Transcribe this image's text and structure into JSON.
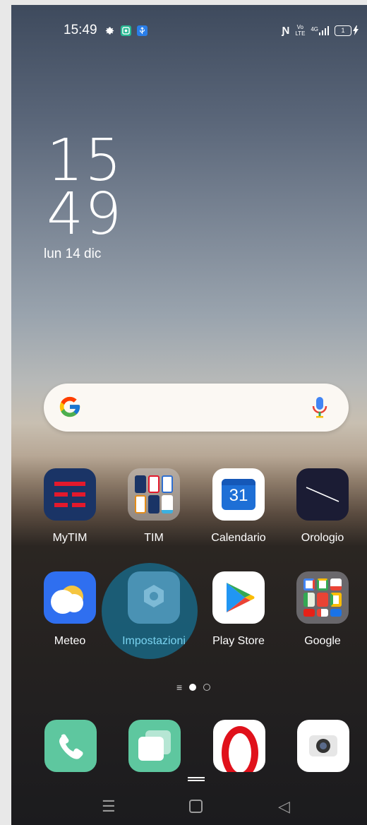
{
  "status_bar": {
    "time": "15:49",
    "left_icons": [
      "gear-icon",
      "screen-record-icon",
      "usb-icon"
    ],
    "right_icons": [
      "nfc-icon",
      "volte-icon",
      "signal-4g-icon",
      "battery-icon"
    ],
    "signal_label": "4G",
    "volte_label": "Vo LTE",
    "battery_level": "1"
  },
  "clock": {
    "hour": "15",
    "minute": "49",
    "date": "lun 14 dic"
  },
  "search": {
    "logo": "G"
  },
  "apps_row1": [
    {
      "label": "MyTIM",
      "icon": "mytim-icon"
    },
    {
      "label": "TIM",
      "icon": "tim-folder-icon"
    },
    {
      "label": "Calendario",
      "icon": "calendar-icon",
      "icon_text": "31"
    },
    {
      "label": "Orologio",
      "icon": "clock-icon"
    }
  ],
  "apps_row2": [
    {
      "label": "Meteo",
      "icon": "weather-icon"
    },
    {
      "label": "Impostazioni",
      "icon": "settings-icon"
    },
    {
      "label": "Play Store",
      "icon": "play-store-icon"
    },
    {
      "label": "Google",
      "icon": "google-folder-icon"
    }
  ],
  "dock": [
    {
      "icon": "phone-icon"
    },
    {
      "icon": "messages-icon"
    },
    {
      "icon": "opera-icon"
    },
    {
      "icon": "camera-icon"
    }
  ],
  "page_indicator": {
    "pages": 2,
    "current": 1
  },
  "colors": {
    "accent_highlight": "#1d6d86",
    "tim_red": "#e3192c",
    "mytim_bg": "#1a3466"
  }
}
